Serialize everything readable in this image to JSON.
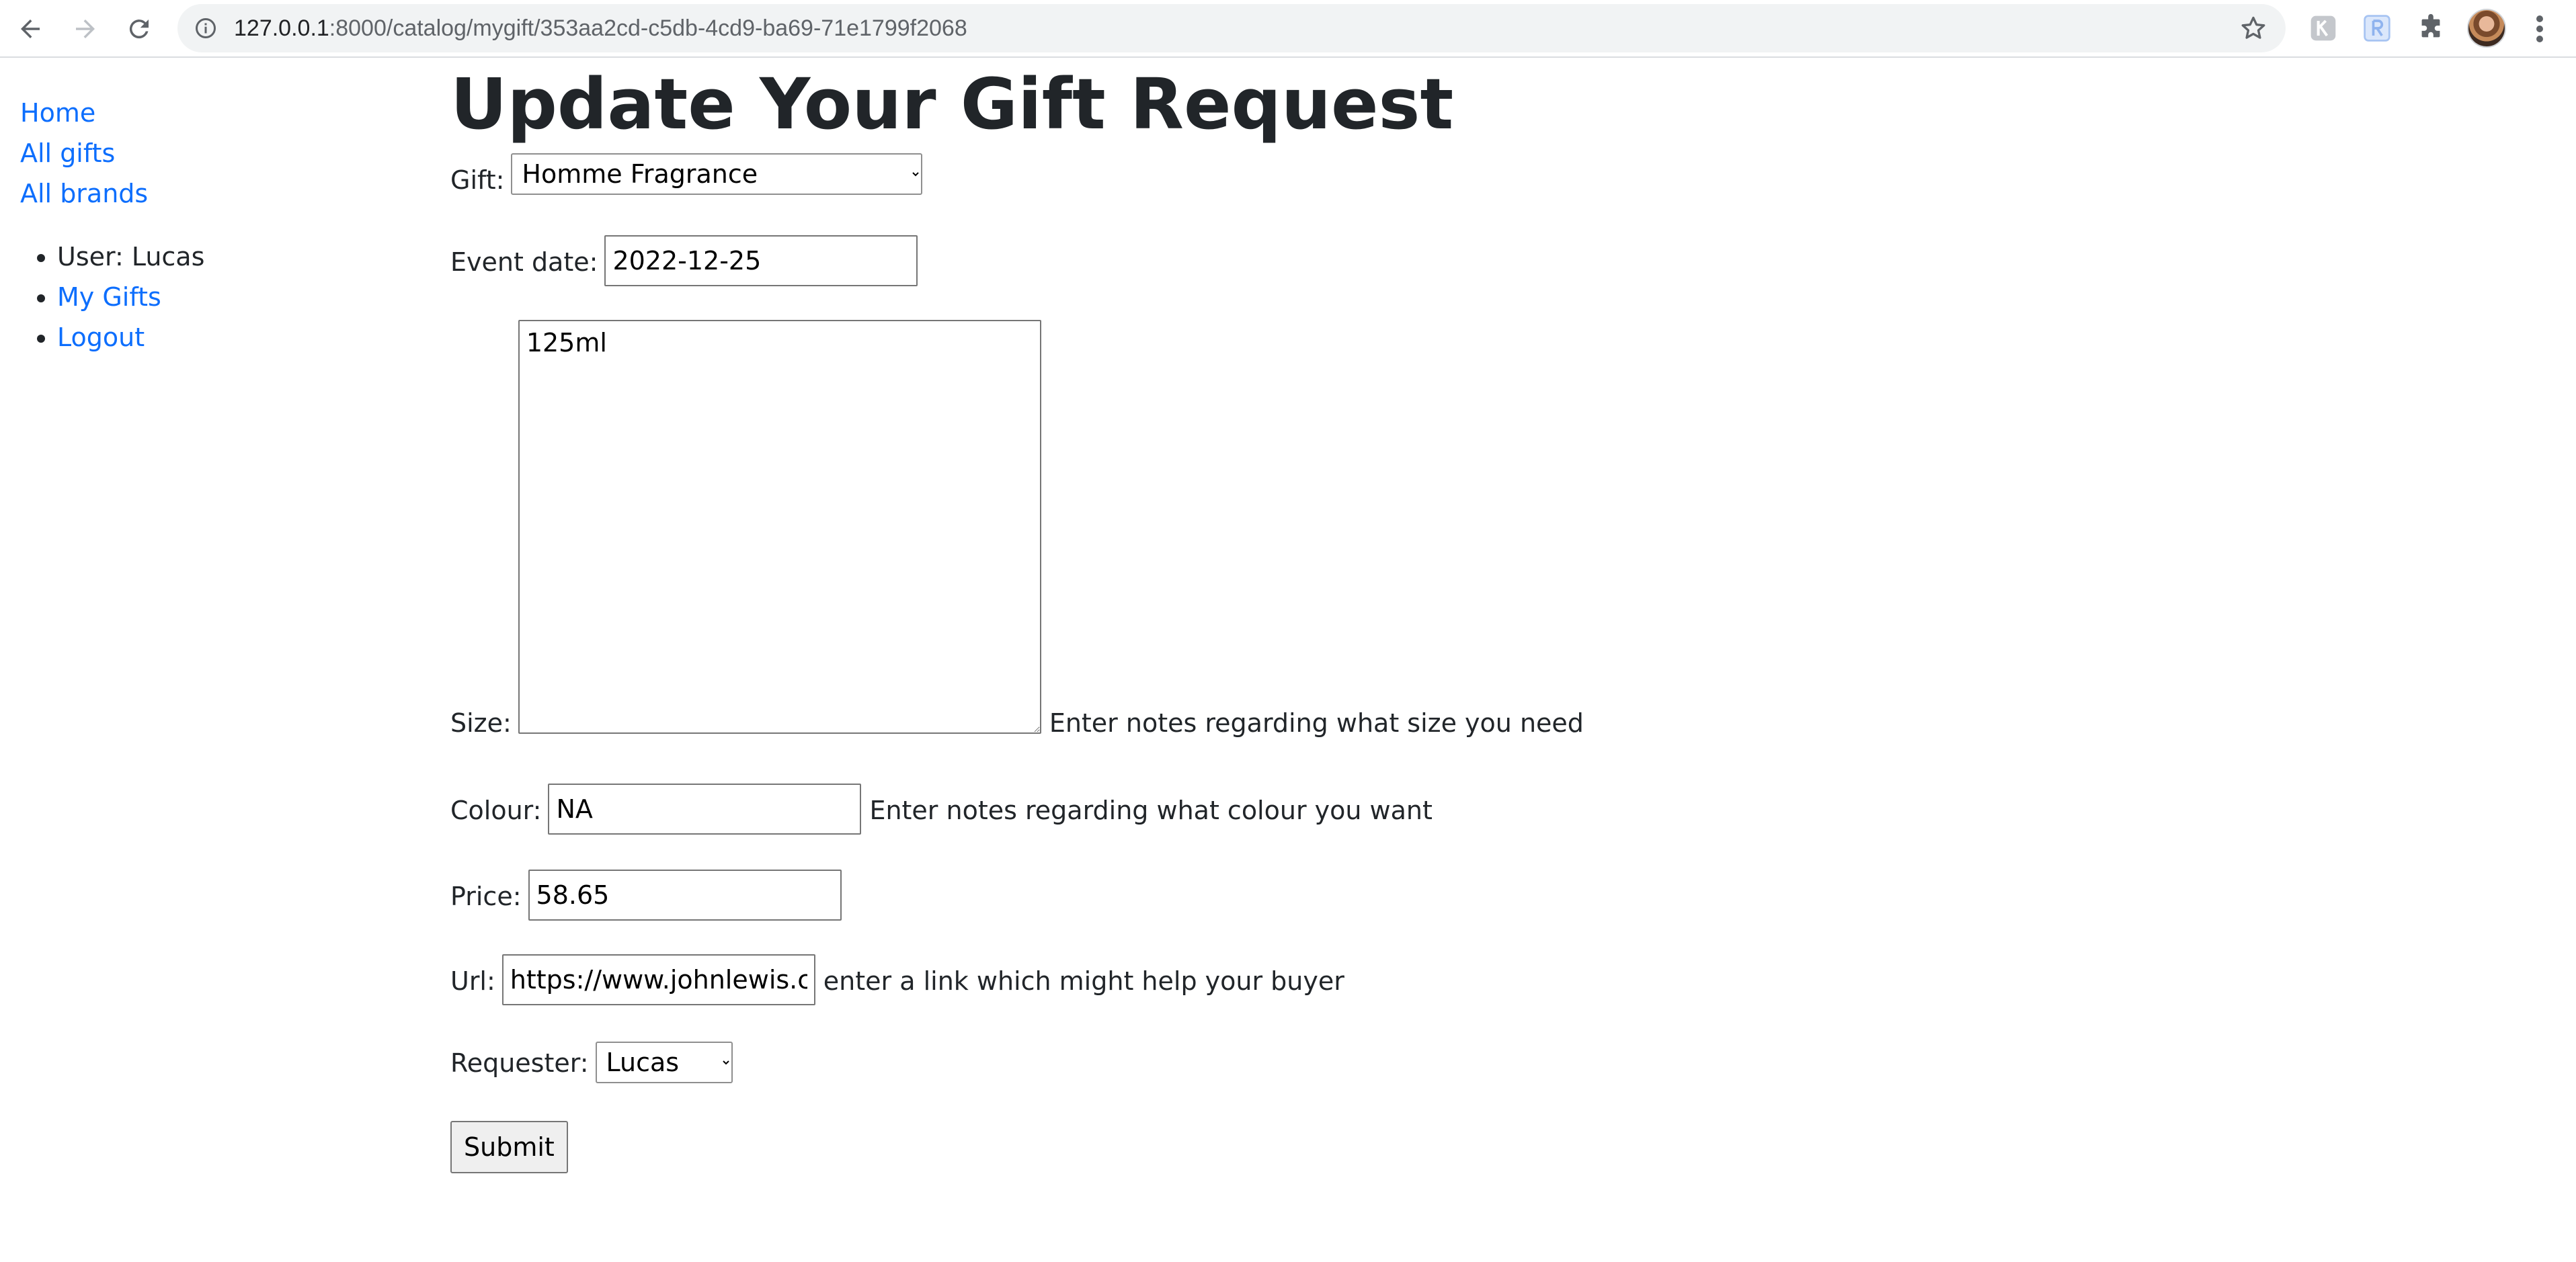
{
  "browser": {
    "url_host": "127.0.0.1",
    "url_rest": ":8000/catalog/mygift/353aa2cd-c5db-4cd9-ba69-71e1799f2068"
  },
  "sidebar": {
    "links": [
      {
        "label": "Home"
      },
      {
        "label": "All gifts"
      },
      {
        "label": "All brands"
      }
    ],
    "user_text": "User: Lucas",
    "my_gifts_label": "My Gifts",
    "logout_label": "Logout"
  },
  "form": {
    "title": "Update Your Gift Request",
    "gift": {
      "label": "Gift:",
      "value": "Homme Fragrance"
    },
    "event_date": {
      "label": "Event date:",
      "value": "2022-12-25"
    },
    "size": {
      "label": "Size:",
      "value": "125ml",
      "help": "Enter notes regarding what size you need"
    },
    "colour": {
      "label": "Colour:",
      "value": "NA",
      "help": "Enter notes regarding what colour you want"
    },
    "price": {
      "label": "Price:",
      "value": "58.65"
    },
    "url": {
      "label": "Url:",
      "value": "https://www.johnlewis.com",
      "help": "enter a link which might help your buyer"
    },
    "requester": {
      "label": "Requester:",
      "value": "Lucas"
    },
    "submit_label": "Submit"
  }
}
